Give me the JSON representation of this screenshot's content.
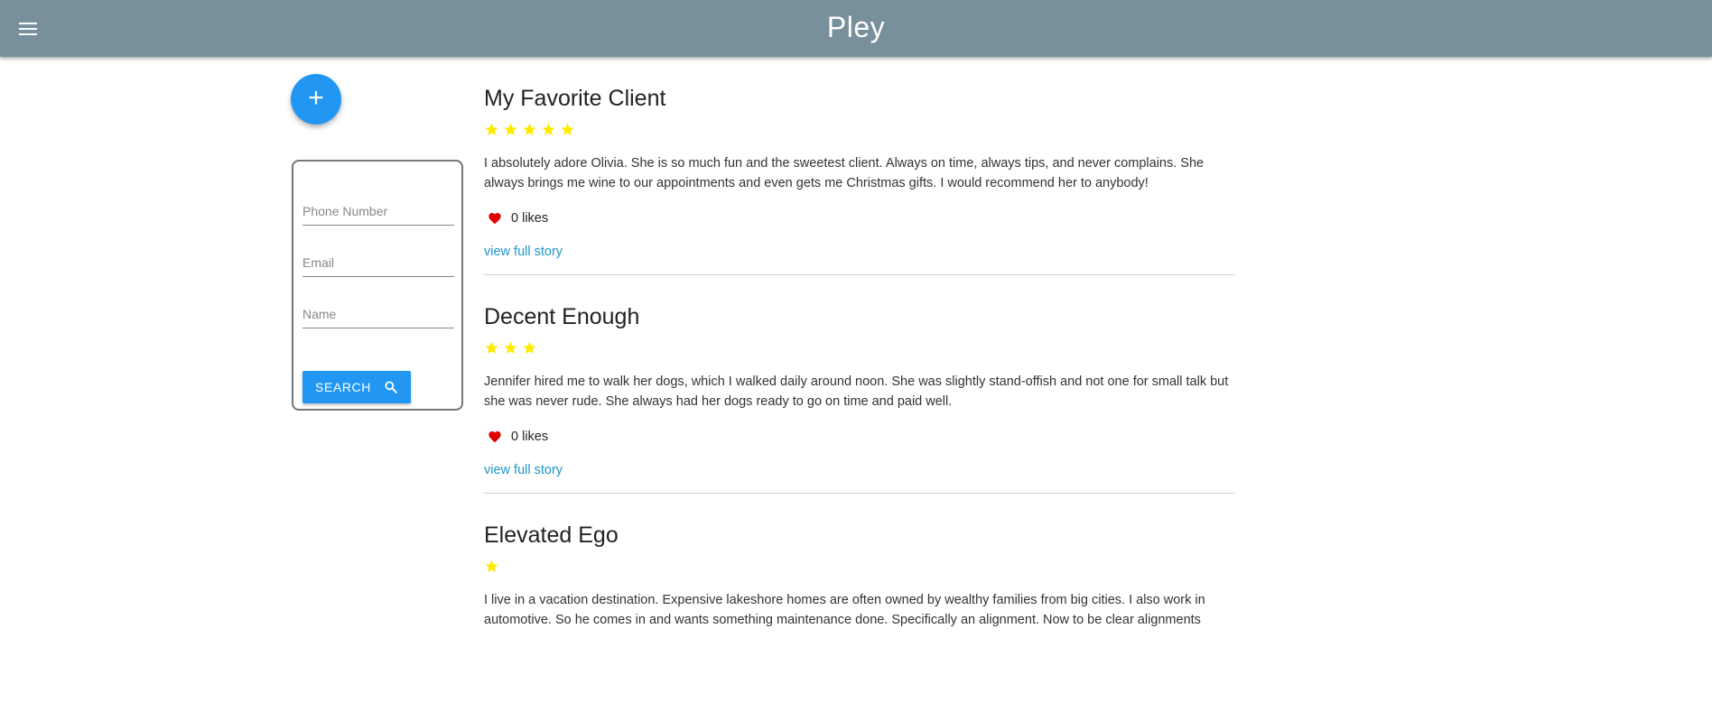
{
  "app": {
    "title": "Pley"
  },
  "sidebar": {
    "add_button_label": "+",
    "search": {
      "phone_placeholder": "Phone Number",
      "email_placeholder": "Email",
      "name_placeholder": "Name",
      "button_label": "SEARCH"
    }
  },
  "stories": [
    {
      "title": "My Favorite Client",
      "rating": 5,
      "body": "I absolutely adore Olivia. She is so much fun and the sweetest client. Always on time, always tips, and never complains. She always brings me wine to our appointments and even gets me Christmas gifts. I would recommend her to anybody!",
      "likes": "0 likes",
      "link": "view full story"
    },
    {
      "title": "Decent Enough",
      "rating": 3,
      "body": "Jennifer hired me to walk her dogs, which I walked daily around noon. She was slightly stand-offish and not one for small talk but she was never rude. She always had her dogs ready to go on time and paid well.",
      "likes": "0 likes",
      "link": "view full story"
    },
    {
      "title": "Elevated Ego",
      "rating": 1,
      "body": "I live in a vacation destination. Expensive lakeshore homes are often owned by wealthy families from big cities. I also work in automotive. So he comes in and wants something maintenance done. Specifically an alignment. Now to be clear alignments",
      "likes": "",
      "link": ""
    }
  ],
  "colors": {
    "appbar": "#78909c",
    "primary": "#2196f3",
    "star": "#ffeb00",
    "heart": "#e00000",
    "link": "#2196c8"
  }
}
